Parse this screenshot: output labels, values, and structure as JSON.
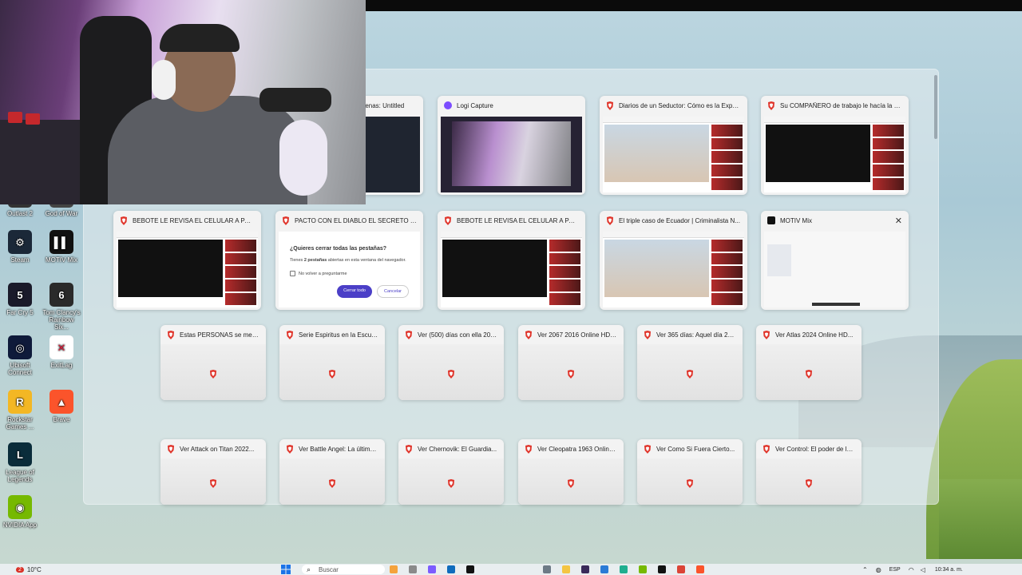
{
  "desktop_icons": [
    {
      "label": "Outlast 2",
      "color": "#333333",
      "glyph": ""
    },
    {
      "label": "God of War",
      "color": "#444444",
      "glyph": ""
    },
    {
      "label": "Steam",
      "color": "#1b2838",
      "glyph": "⚙"
    },
    {
      "label": "MOTIV Mix",
      "color": "#111111",
      "glyph": "▌▌"
    },
    {
      "label": "Far Cry 5",
      "color": "#1a1a2a",
      "glyph": "5"
    },
    {
      "label": "Tom Clancy's Rainbow Six...",
      "color": "#2a2a2a",
      "glyph": "6"
    },
    {
      "label": "Ubisoft Connect",
      "color": "#0f1a3a",
      "glyph": "◎"
    },
    {
      "label": "ExitLag",
      "color": "#ffffff",
      "glyph": "✕"
    },
    {
      "label": "Rockstar Games ...",
      "color": "#f3b724",
      "glyph": "R"
    },
    {
      "label": "Brave",
      "color": "#fb542b",
      "glyph": "▲"
    },
    {
      "label": "League of Legends",
      "color": "#0a2c3a",
      "glyph": "L"
    },
    {
      "label": "NVIDIA App",
      "color": "#76b900",
      "glyph": "◉"
    }
  ],
  "windows_row1": [
    {
      "title": "Escenas: Untitled",
      "icon": "obs-icon"
    },
    {
      "title": "Logi Capture",
      "icon": "logi-icon"
    },
    {
      "title": "Diarios de un Seductor: Cómo es la Exper...",
      "icon": "brave-icon"
    },
    {
      "title": "Su COMPAÑERO de trabajo le hacía la S...",
      "icon": "brave-icon"
    }
  ],
  "windows_row2": [
    {
      "title": "BEBOTE LE REVISA EL CELULAR A PAREJA...",
      "icon": "brave-icon"
    },
    {
      "title": "PACTO CON EL DIABLO EL SECRETO DE L...",
      "icon": "brave-icon"
    },
    {
      "title": "BEBOTE LE REVISA EL CELULAR A PAREJA...",
      "icon": "brave-icon"
    },
    {
      "title": "El triple caso de Ecuador | Criminalista N...",
      "icon": "brave-icon"
    },
    {
      "title": "MOTIV Mix",
      "icon": "motiv-icon",
      "close": "✕"
    }
  ],
  "dialog": {
    "question": "¿Quieres cerrar todas las pestañas?",
    "message_prefix": "Tienes ",
    "message_bold": "2 pestañas",
    "message_suffix": " abiertas en esta ventana del navegador.",
    "checkbox": "No volver a preguntarme",
    "confirm": "Cerrar todo",
    "cancel": "Cancelar"
  },
  "windows_row3": [
    {
      "title": "Estas PERSONAS se metier..."
    },
    {
      "title": "Serie Espiritus en la Escuel..."
    },
    {
      "title": "Ver (500) días con ella 200..."
    },
    {
      "title": "Ver 2067 2016 Online HD -..."
    },
    {
      "title": "Ver 365 días: Aquel día 20..."
    },
    {
      "title": "Ver Atlas 2024 Online HD..."
    }
  ],
  "windows_row4": [
    {
      "title": "Ver Attack on Titan 2022..."
    },
    {
      "title": "Ver Battle Angel: La última..."
    },
    {
      "title": "Ver Chernovik: El Guardia..."
    },
    {
      "title": "Ver Cleopatra 1963 Online..."
    },
    {
      "title": "Ver Como Si Fuera Cierto..."
    },
    {
      "title": "Ver Control: El poder de la..."
    }
  ],
  "taskbar": {
    "weather_badge": "2",
    "temperature": "10°C",
    "search_placeholder": "Buscar",
    "lang": "ESP",
    "time": "10:34 a. m."
  }
}
